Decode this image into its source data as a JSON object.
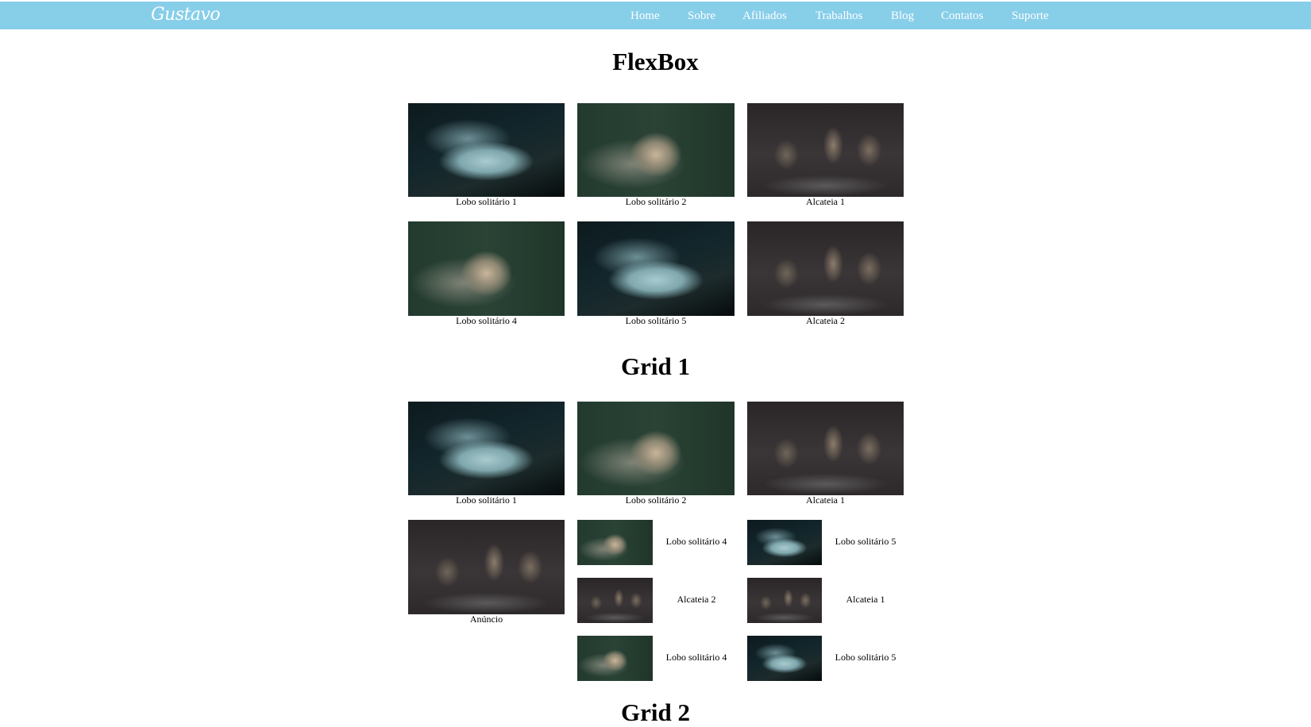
{
  "header": {
    "logo": "Gustavo",
    "nav": [
      "Home",
      "Sobre",
      "Afiliados",
      "Trabalhos",
      "Blog",
      "Contatos",
      "Suporte"
    ],
    "bg_color": "#87cee9"
  },
  "sections": {
    "flexbox": {
      "title": "FlexBox",
      "items": [
        {
          "caption": "Lobo solitário 1",
          "image": "white-wolf"
        },
        {
          "caption": "Lobo solitário 2",
          "image": "gray-wolf"
        },
        {
          "caption": "Alcateia 1",
          "image": "wolf-pack"
        },
        {
          "caption": "Lobo solitário 4",
          "image": "gray-wolf"
        },
        {
          "caption": "Lobo solitário 5",
          "image": "white-wolf"
        },
        {
          "caption": "Alcateia 2",
          "image": "wolf-pack"
        }
      ]
    },
    "grid1": {
      "title": "Grid 1",
      "top_items": [
        {
          "caption": "Lobo solitário 1",
          "image": "white-wolf"
        },
        {
          "caption": "Lobo solitário 2",
          "image": "gray-wolf"
        },
        {
          "caption": "Alcateia 1",
          "image": "wolf-pack"
        }
      ],
      "ad": {
        "caption": "Anúncio",
        "image": "wolf-pack"
      },
      "small_items": [
        {
          "caption": "Lobo solitário 4",
          "image": "gray-wolf"
        },
        {
          "caption": "Lobo solitário 5",
          "image": "white-wolf"
        },
        {
          "caption": "Alcateia 2",
          "image": "wolf-pack"
        },
        {
          "caption": "Alcateia 1",
          "image": "wolf-pack"
        },
        {
          "caption": "Lobo solitário 4",
          "image": "gray-wolf"
        },
        {
          "caption": "Lobo solitário 5",
          "image": "white-wolf"
        }
      ]
    },
    "grid2": {
      "title": "Grid 2"
    }
  }
}
